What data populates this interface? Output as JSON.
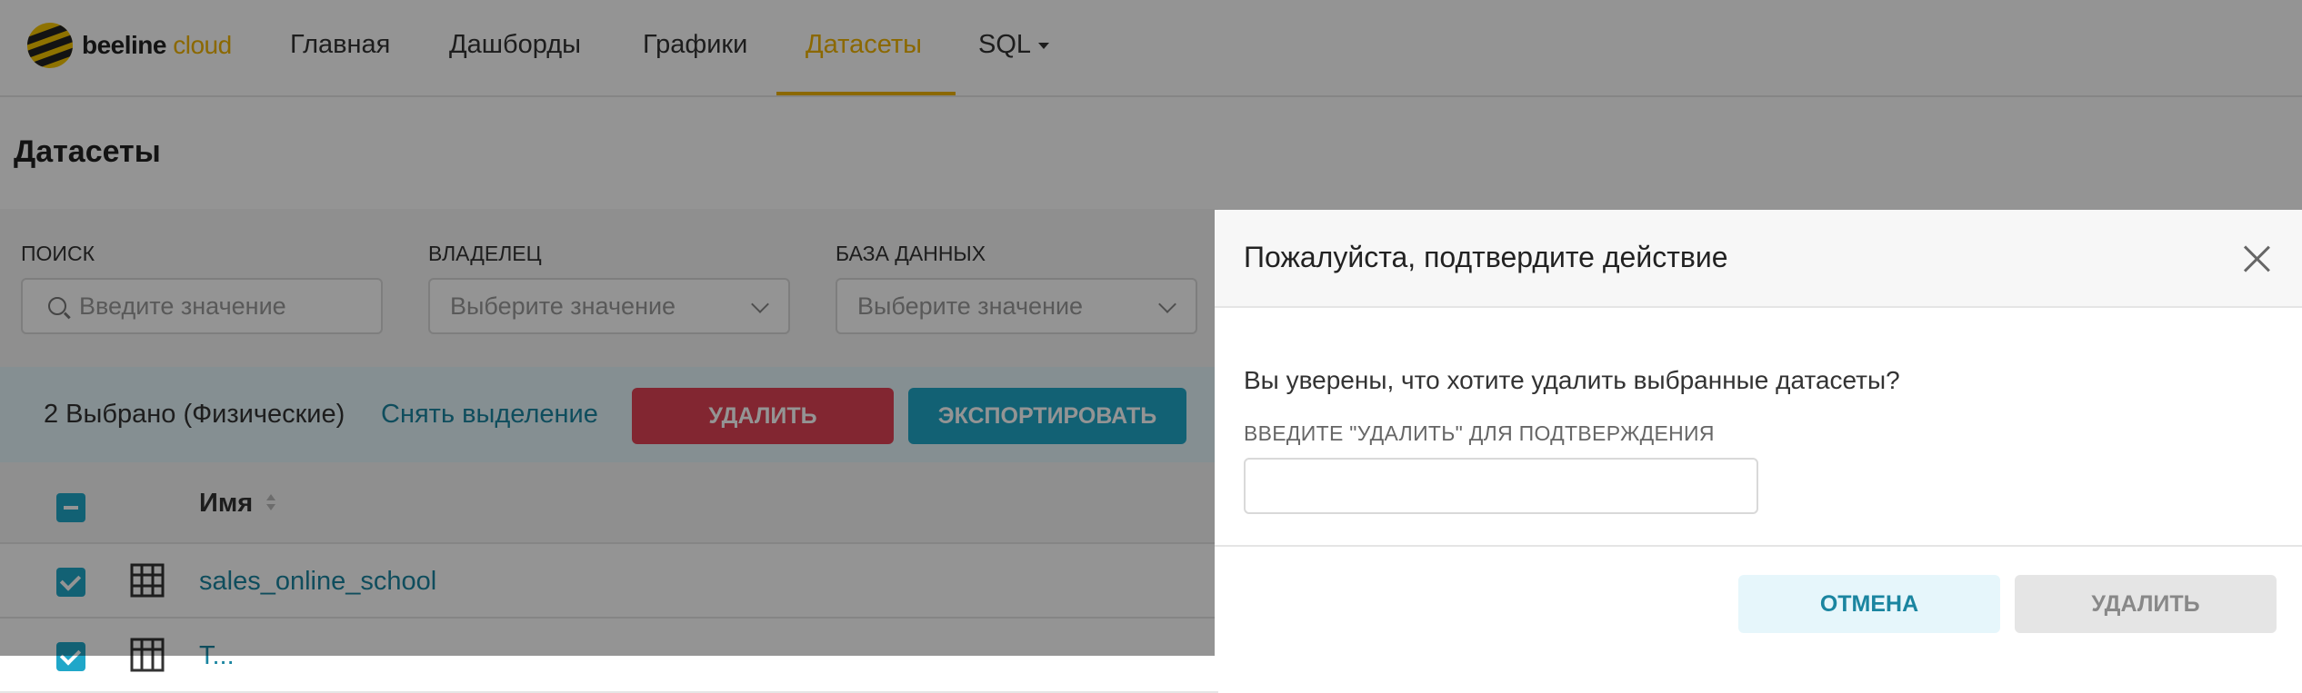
{
  "brand": {
    "name": "beeline",
    "suffix": "cloud"
  },
  "nav": {
    "items": [
      {
        "label": "Главная"
      },
      {
        "label": "Дашборды"
      },
      {
        "label": "Графики"
      },
      {
        "label": "Датасеты"
      },
      {
        "label": "SQL"
      }
    ],
    "active": "Датасеты"
  },
  "page": {
    "title": "Датасеты"
  },
  "filters": {
    "search": {
      "label": "ПОИСК",
      "placeholder": "Введите значение"
    },
    "owner": {
      "label": "ВЛАДЕЛЕЦ",
      "placeholder": "Выберите значение"
    },
    "database": {
      "label": "БАЗА ДАННЫХ",
      "placeholder": "Выберите значение"
    }
  },
  "bulk": {
    "selected_text": "2 Выбрано (Физические)",
    "deselect_label": "Снять выделение",
    "delete_label": "УДАЛИТЬ",
    "export_label": "ЭКСПОРТИРОВАТЬ"
  },
  "table": {
    "columns": [
      {
        "label": "Имя"
      }
    ],
    "rows": [
      {
        "name": "sales_online_school",
        "checked": true
      },
      {
        "name": "T...",
        "checked": true
      }
    ]
  },
  "modal": {
    "title": "Пожалуйста, подтвердите действие",
    "question": "Вы уверены, что хотите удалить выбранные датасеты?",
    "hint": "ВВЕДИТЕ \"УДАЛИТЬ\" ДЛЯ ПОДТВЕРЖДЕНИЯ",
    "input_value": "",
    "cancel_label": "ОТМЕНА",
    "confirm_label": "УДАЛИТЬ"
  },
  "colors": {
    "accent": "#f0b400",
    "primary": "#20a7c9",
    "danger": "#e04355",
    "link": "#1a85a0"
  }
}
